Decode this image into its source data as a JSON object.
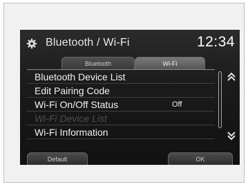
{
  "header": {
    "title": "Bluetooth / Wi-Fi",
    "clock": "12:34",
    "settings_icon": "gear-icon"
  },
  "tabs": [
    {
      "label": "Bluetooth",
      "selected": false
    },
    {
      "label": "Wi-Fi",
      "selected": true
    }
  ],
  "menu": {
    "items": [
      {
        "label": "Bluetooth Device List",
        "value": "",
        "enabled": true
      },
      {
        "label": "Edit Pairing Code",
        "value": "",
        "enabled": true
      },
      {
        "label": "Wi-Fi On/Off Status",
        "value": "Off",
        "enabled": true
      },
      {
        "label": "Wi-Fi Device List",
        "value": "",
        "enabled": false
      },
      {
        "label": "Wi-Fi Information",
        "value": "",
        "enabled": true
      }
    ],
    "scroll_up_icon": "double-chevron-up-icon",
    "scroll_down_icon": "double-chevron-down-icon"
  },
  "footer": {
    "default_label": "Default",
    "ok_label": "OK"
  }
}
